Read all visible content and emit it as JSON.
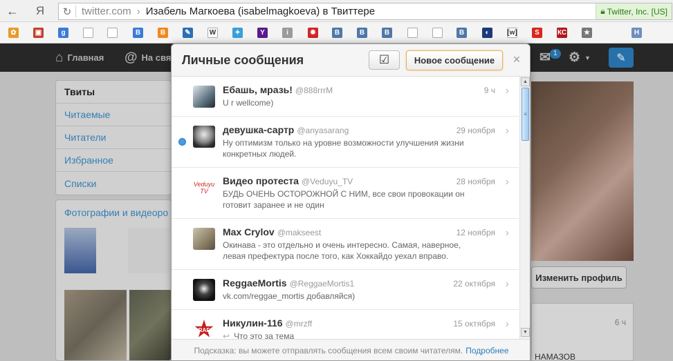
{
  "browser": {
    "logo": "Я",
    "url_host": "twitter.com",
    "url_arrow": "›",
    "page_title": "Изабель Магкоева (isabelmagkoeva) в Твиттере",
    "ssl_label": "Twitter, Inc. [US]",
    "bookmarks": [
      {
        "icon": "puzzle-icon",
        "color": "#e89a2a",
        "glyph": "✿"
      },
      {
        "icon": "screen-icon",
        "color": "#c2422e",
        "glyph": "▣"
      },
      {
        "icon": "google-icon",
        "color": "#3b7bd8",
        "glyph": "g"
      },
      {
        "icon": "page-icon",
        "color": "#ffffff",
        "glyph": ""
      },
      {
        "icon": "page-icon",
        "color": "#ffffff",
        "glyph": ""
      },
      {
        "icon": "blog-icon",
        "color": "#3b7bd8",
        "glyph": "B"
      },
      {
        "icon": "rss-icon",
        "color": "#f0891e",
        "glyph": "B"
      },
      {
        "icon": "clip-icon",
        "color": "#2c6fb5",
        "glyph": "✎"
      },
      {
        "icon": "wikipedia-icon",
        "color": "#ffffff",
        "glyph": "W"
      },
      {
        "icon": "twitter-bird-icon",
        "color": "#3a9fd9",
        "glyph": "✦"
      },
      {
        "icon": "yahoo-icon",
        "color": "#5a1a8e",
        "glyph": "Y"
      },
      {
        "icon": "info-icon",
        "color": "#9a9a9a",
        "glyph": "i"
      },
      {
        "icon": "virus-icon",
        "color": "#d12525",
        "glyph": "✹"
      },
      {
        "icon": "vk-icon",
        "color": "#4e78a8",
        "glyph": "В"
      },
      {
        "icon": "vk-icon",
        "color": "#4e78a8",
        "glyph": "В"
      },
      {
        "icon": "vk-icon",
        "color": "#4e78a8",
        "glyph": "В"
      },
      {
        "icon": "page-icon",
        "color": "#ffffff",
        "glyph": ""
      },
      {
        "icon": "page-icon",
        "color": "#ffffff",
        "glyph": ""
      },
      {
        "icon": "vk-icon",
        "color": "#4e78a8",
        "glyph": "В"
      },
      {
        "icon": "moon-icon",
        "color": "#1b3a7a",
        "glyph": "◐"
      },
      {
        "icon": "w-bracket-icon",
        "color": "#ffffff",
        "glyph": "[w]"
      },
      {
        "icon": "s-icon",
        "color": "#d9261c",
        "glyph": "S"
      },
      {
        "icon": "kc-icon",
        "color": "#b3171c",
        "glyph": "КС"
      },
      {
        "icon": "star-icon",
        "color": "#777777",
        "glyph": "★"
      },
      {
        "icon": "h-icon",
        "color": "#6c8fbf",
        "glyph": "H"
      }
    ]
  },
  "topbar": {
    "home": "Главная",
    "connect": "На связ",
    "messages_count": "1"
  },
  "sidebar": {
    "items": [
      {
        "label": "Твиты",
        "active": true
      },
      {
        "label": "Читаемые",
        "active": false
      },
      {
        "label": "Читатели",
        "active": false
      },
      {
        "label": "Избранное",
        "active": false
      },
      {
        "label": "Списки",
        "active": false
      }
    ],
    "photos_title": "Фотографии и видеоро"
  },
  "profile": {
    "edit_button": "Изменить профиль",
    "right_time": "6 ч",
    "right_text": "НАМАЗОВ"
  },
  "modal": {
    "title": "Личные сообщения",
    "new_message_button": "Новое сообщение",
    "close": "×",
    "footer_hint": "Подсказка: вы можете отправлять сообщения всем своим читателям.",
    "footer_link": "Подробнее",
    "conversations": [
      {
        "name": "Ебашь, мразь!",
        "handle": "@888rrrM",
        "time": "9 ч",
        "text": "U r wellcome)",
        "unread": false,
        "avatar": "avatar-1",
        "reply": false
      },
      {
        "name": "девушка-сартр",
        "handle": "@anyasarang",
        "time": "29 ноября",
        "text": "Ну оптимизм только на уровне возможности улучшения жизни конкретных людей.",
        "unread": true,
        "avatar": "avatar-2",
        "reply": false
      },
      {
        "name": "Видео протеста",
        "handle": "@Veduyu_TV",
        "time": "28 ноября",
        "text": "БУДЬ ОЧЕНЬ ОСТОРОЖНОЙ С НИМ, все свои провокации он готовит заранее и не один",
        "unread": false,
        "avatar": "avatar-3",
        "avatar_text": "Veduyu TV",
        "reply": false
      },
      {
        "name": "Max Crylov",
        "handle": "@makseest",
        "time": "12 ноября",
        "text": "Окинава - это отдельно и очень интересно. Самая, наверное, левая префектура после того, как Хоккайдо уехал вправо.",
        "unread": false,
        "avatar": "avatar-4",
        "reply": false
      },
      {
        "name": "ReggaeMortis",
        "handle": "@ReggaeMortis1",
        "time": "22 октября",
        "text": "vk.com/reggae_mortis добавляйся)",
        "unread": false,
        "avatar": "avatar-5",
        "reply": false
      },
      {
        "name": "Никулин-116",
        "handle": "@mrzff",
        "time": "15 октября",
        "text": "Что это за тема",
        "unread": false,
        "avatar": "avatar-6",
        "avatar_text": "RAF",
        "reply": true
      }
    ]
  }
}
